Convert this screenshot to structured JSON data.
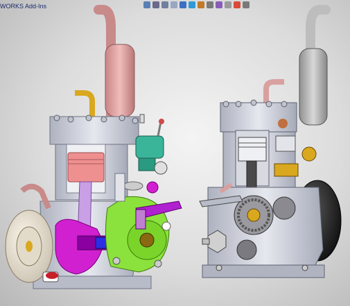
{
  "window": {
    "tab_label": "WORKS Add-Ins"
  },
  "toolbar": {
    "icons": [
      {
        "name": "view-orientation-icon",
        "color": "#5a7fb5"
      },
      {
        "name": "zoom-fit-icon",
        "color": "#6a6a8a"
      },
      {
        "name": "zoom-area-icon",
        "color": "#6f7f9f"
      },
      {
        "name": "previous-view-icon",
        "color": "#9aa7c0"
      },
      {
        "name": "section-view-icon",
        "color": "#3d6fc4"
      },
      {
        "name": "display-style-icon",
        "color": "#2f9ad6"
      },
      {
        "name": "hide-show-icon",
        "color": "#c27a2a"
      },
      {
        "name": "edit-appearance-icon",
        "color": "#7a7a7a"
      },
      {
        "name": "scene-icon",
        "color": "#8a5cb8"
      },
      {
        "name": "view-settings-icon",
        "color": "#9a9a9a"
      },
      {
        "name": "appearances-icon",
        "color": "#d94a3a"
      },
      {
        "name": "lights-icon",
        "color": "#7a7a7a"
      }
    ]
  },
  "colors": {
    "background": "#d9d9d9",
    "casting": "#c9ccd6",
    "exhaust_left": "#d9a0a0",
    "exhaust_right": "#c0c0c0",
    "piston": "#ee8f90",
    "crank": "#d020d0",
    "cam_housing": "#8ce23c",
    "carburetor": "#3bb59a",
    "brass": "#d9a81f",
    "flywheel_left": "#ede6d8",
    "flywheel_right": "#222222"
  }
}
